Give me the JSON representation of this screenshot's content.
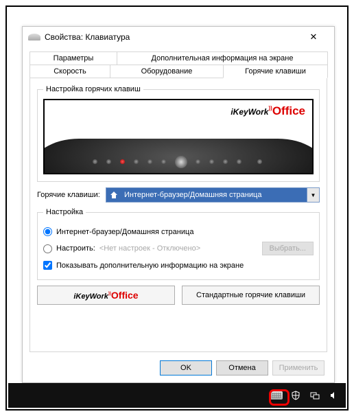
{
  "window": {
    "title": "Свойства: Клавиатура"
  },
  "tabs": {
    "row1": [
      "Параметры",
      "Дополнительная информация на экране"
    ],
    "row2": [
      "Скорость",
      "Оборудование",
      "Горячие клавиши"
    ]
  },
  "group1": {
    "legend": "Настройка горячих клавиш",
    "logo_ikey": "iKeyWork",
    "logo_office": "Office"
  },
  "hotkey": {
    "label": "Горячие клавиши:",
    "selected": "Интернет-браузер/Домашняя страница"
  },
  "settings": {
    "legend": "Настройка",
    "opt1": "Интернет-браузер/Домашняя страница",
    "opt2": "Настроить:",
    "opt2_hint": "<Нет настроек - Отключено>",
    "browse": "Выбрать...",
    "checkbox": "Показывать дополнительную информацию на экране"
  },
  "buttons": {
    "logo_ikey": "iKeyWork",
    "logo_office": "Office",
    "defaults": "Стандартные горячие клавиши"
  },
  "dialog": {
    "ok": "OK",
    "cancel": "Отмена",
    "apply": "Применить"
  }
}
